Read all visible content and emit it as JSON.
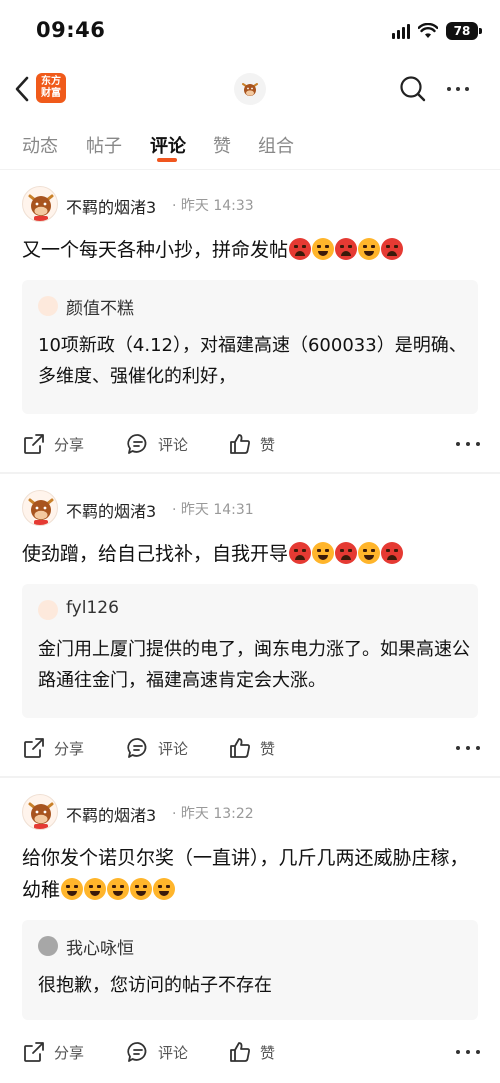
{
  "status_bar": {
    "time": "09:46",
    "battery": "78"
  },
  "header": {
    "app_logo_line1": "东方",
    "app_logo_line2": "财富"
  },
  "tabs": [
    {
      "label": "动态"
    },
    {
      "label": "帖子"
    },
    {
      "label": "评论"
    },
    {
      "label": "赞"
    },
    {
      "label": "组合"
    }
  ],
  "active_tab": "评论",
  "actions": {
    "share": "分享",
    "comment": "评论",
    "like": "赞"
  },
  "posts": [
    {
      "author": "不羁的烟渚3",
      "time": "· 昨天 14:33",
      "text": "又一个每天各种小抄，拼命发帖",
      "emojis": [
        "angry",
        "laugh",
        "angry",
        "laugh",
        "angry"
      ],
      "quote": {
        "author": "颜值不糕",
        "text": "10项新政（4.12），对福建高速（600033）是明确、多维度、强催化的利好，"
      }
    },
    {
      "author": "不羁的烟渚3",
      "time": "· 昨天 14:31",
      "text": "使劲蹭，给自己找补，自我开导",
      "emojis": [
        "angry",
        "laugh",
        "angry",
        "laugh",
        "angry"
      ],
      "quote": {
        "author": "fyl126",
        "text": "金门用上厦门提供的电了，闽东电力涨了。如果高速公路通往金门，福建高速肯定会大涨。"
      }
    },
    {
      "author": "不羁的烟渚3",
      "time": "· 昨天 13:22",
      "text": "给你发个诺贝尔奖（一直讲），几斤几两还威胁庄稼，幼稚",
      "emojis": [
        "laugh",
        "laugh",
        "laugh",
        "laugh",
        "laugh"
      ],
      "quote": {
        "author": "我心咏恒",
        "text": "很抱歉，您访问的帖子不存在"
      }
    }
  ],
  "colors": {
    "accent": "#f0561f",
    "brand": "#f05a1a",
    "quote_bg": "#f7f7f7"
  }
}
